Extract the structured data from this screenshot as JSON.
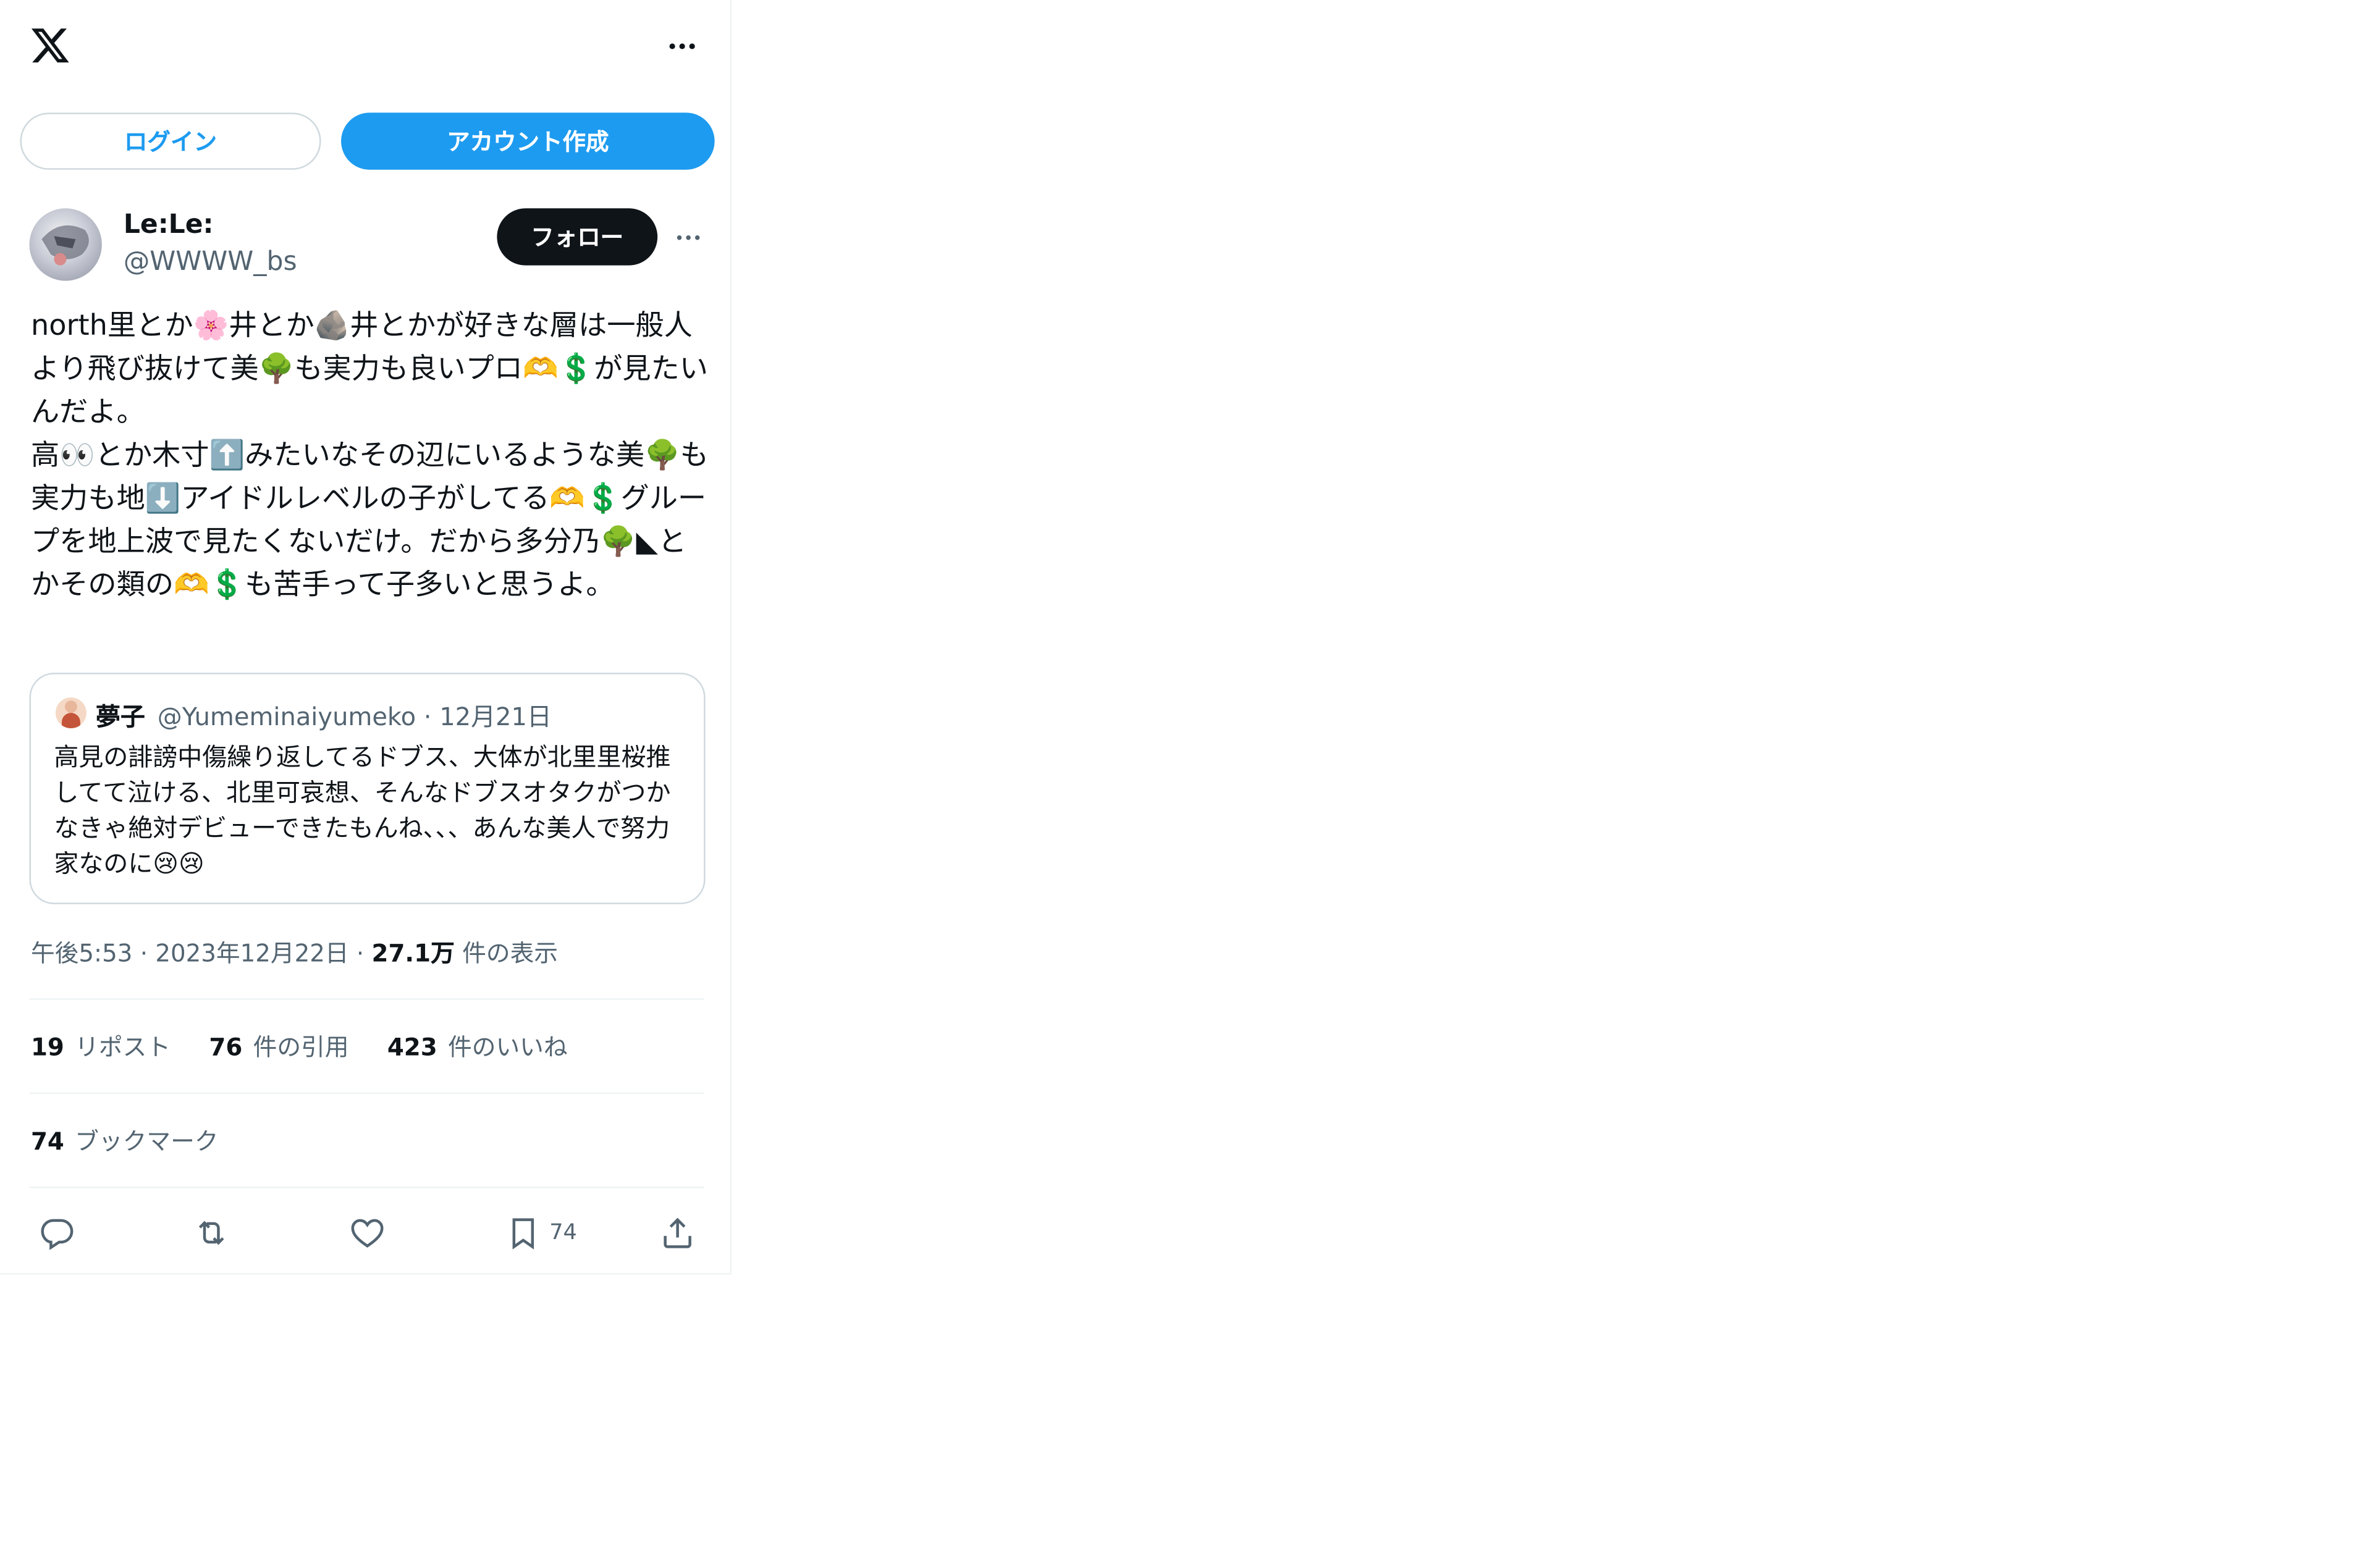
{
  "header": {
    "logo_icon": "x-logo-icon",
    "more_icon": "more-horizontal-icon"
  },
  "auth": {
    "login_label": "ログイン",
    "signup_label": "アカウント作成"
  },
  "tweet": {
    "author": {
      "display_name": "Le:Le:",
      "handle": "@WWWW_bs"
    },
    "follow_label": "フォロー",
    "text": "north里とか🌸井とか🪨井とかが好きな層は一般人より飛び抜けて美🌳も実力も良いプロ🫶💲が見たいんだよ。\n高👀とか木寸⬆️みたいなその辺にいるような美🌳も実力も地⬇️アイドルレベルの子がしてる🫶💲グループを地上波で見たくないだけ。だから多分乃🌳◣とかその類の🫶💲も苦手って子多いと思うよ。",
    "quote": {
      "name": "夢子",
      "handle": "@Yumeminaiyumeko",
      "date": "12月21日",
      "handle_line": "@Yumeminaiyumeko · 12月21日",
      "text": "高見の誹謗中傷繰り返してるドブス、大体が北里里桜推してて泣ける、北里可哀想、そんなドブスオタクがつかなきゃ絶対デビューできたもんね、、、あんな美人で努力家なのに😢😢"
    },
    "time": "午後5:53",
    "date": "2023年12月22日",
    "views_count": "27.1万",
    "views_label": "件の表示",
    "stats": {
      "reposts_count": "19",
      "reposts_label": "リポスト",
      "quotes_count": "76",
      "quotes_label": "件の引用",
      "likes_count": "423",
      "likes_label": "件のいいね",
      "bookmarks_count": "74",
      "bookmarks_label": "ブックマーク"
    },
    "actions": {
      "reply_icon": "reply-icon",
      "retweet_icon": "retweet-icon",
      "like_icon": "heart-icon",
      "bookmark_icon": "bookmark-icon",
      "bookmark_count": "74",
      "share_icon": "share-icon"
    }
  },
  "colors": {
    "accent": "#1d9bf0",
    "text": "#0f1419",
    "secondary": "#536471",
    "border": "#cfd9de"
  }
}
